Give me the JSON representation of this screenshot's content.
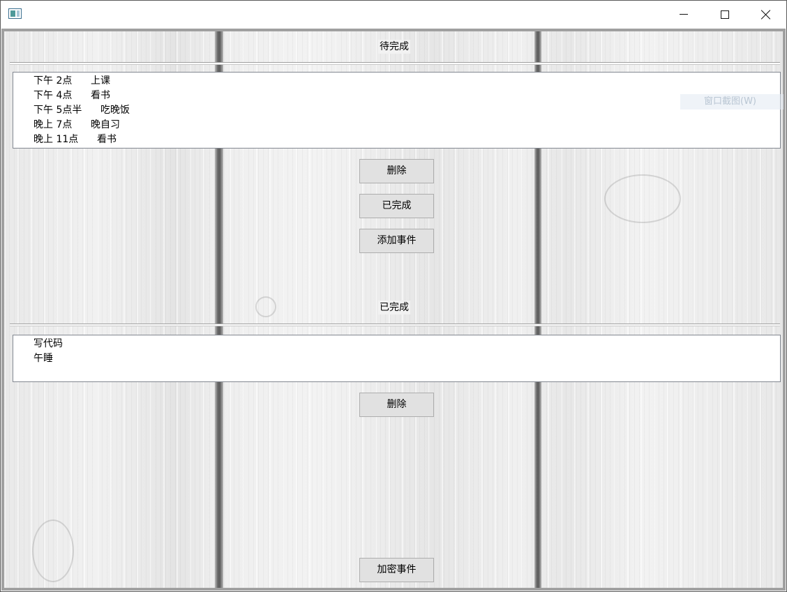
{
  "window": {
    "title": "",
    "controls": {
      "minimize": "minimize-icon",
      "maximize": "maximize-icon",
      "close": "close-icon"
    }
  },
  "pending": {
    "label": "待完成",
    "items": [
      "下午 2点      上课",
      "下午 4点      看书",
      "下午 5点半      吃晚饭",
      "晚上 7点      晚自习",
      "晚上 11点      看书"
    ],
    "delete_label": "删除",
    "complete_label": "已完成",
    "add_label": "添加事件"
  },
  "done": {
    "label": "已完成",
    "items": [
      "写代码",
      "午睡"
    ],
    "delete_label": "删除"
  },
  "encrypt_label": "加密事件",
  "ghost_overlay_text": "窗口截图(W)",
  "colors": {
    "button_bg": "#e1e1e1",
    "button_border": "#adadad",
    "window_border": "#a0a0a0"
  }
}
